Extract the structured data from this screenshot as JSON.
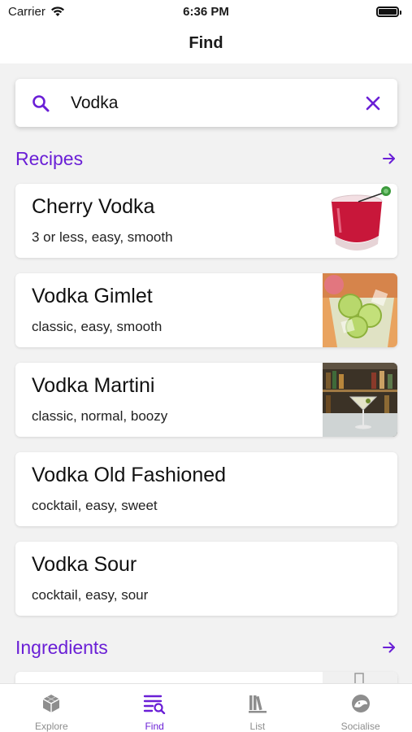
{
  "status_bar": {
    "carrier": "Carrier",
    "time": "6:36 PM"
  },
  "nav": {
    "title": "Find"
  },
  "search": {
    "value": "Vodka"
  },
  "colors": {
    "accent": "#6a1fd6",
    "inactive": "#8e8e8e"
  },
  "sections": {
    "recipes": {
      "title": "Recipes"
    },
    "ingredients": {
      "title": "Ingredients"
    }
  },
  "recipes": [
    {
      "title": "Cherry Vodka",
      "tags": "3 or less, easy, smooth",
      "image": "cherry-vodka-image"
    },
    {
      "title": "Vodka Gimlet",
      "tags": "classic, easy, smooth",
      "image": "vodka-gimlet-image"
    },
    {
      "title": "Vodka Martini",
      "tags": "classic, normal, boozy",
      "image": "vodka-martini-image"
    },
    {
      "title": "Vodka Old Fashioned",
      "tags": "cocktail, easy, sweet"
    },
    {
      "title": "Vodka Sour",
      "tags": "cocktail, easy, sour"
    }
  ],
  "tabs": [
    {
      "label": "Explore",
      "icon": "cube-icon",
      "active": false
    },
    {
      "label": "Find",
      "icon": "search-list-icon",
      "active": true
    },
    {
      "label": "List",
      "icon": "books-icon",
      "active": false
    },
    {
      "label": "Socialise",
      "icon": "chat-icon",
      "active": false
    }
  ]
}
